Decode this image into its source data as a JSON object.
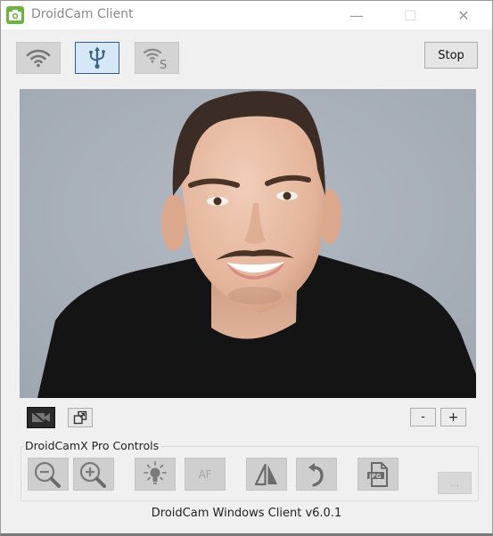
{
  "window": {
    "title": "DroidCam Client",
    "controls": {
      "minimize": "—",
      "maximize": "☐",
      "close": "✕"
    }
  },
  "connection": {
    "buttons": [
      {
        "id": "wifi",
        "icon": "wifi-icon",
        "active": false
      },
      {
        "id": "usb",
        "icon": "usb-icon",
        "active": true
      },
      {
        "id": "wifi-server",
        "icon": "wifi-s-icon",
        "label": "S",
        "active": false
      }
    ],
    "stop_label": "Stop"
  },
  "video": {
    "description": "Live camera preview: smiling man with short hair and mustache, black t-shirt, grey background",
    "background_color": "#a8b0ba"
  },
  "preview_controls": {
    "camera_toggle_icon": "camera-off-icon",
    "popout_icon": "popout-window-icon",
    "zoom_out_label": "-",
    "zoom_in_label": "+"
  },
  "pro_controls": {
    "group_label": "DroidCamX Pro Controls",
    "buttons": [
      {
        "id": "zoom-out",
        "icon": "zoom-out-icon"
      },
      {
        "id": "zoom-in",
        "icon": "zoom-in-icon"
      },
      {
        "id": "light",
        "icon": "lightbulb-icon"
      },
      {
        "id": "autofocus",
        "label": "AF"
      },
      {
        "id": "mirror",
        "icon": "mirror-flip-icon"
      },
      {
        "id": "rotate",
        "icon": "rotate-icon"
      },
      {
        "id": "save-jpg",
        "icon": "jpg-file-icon",
        "label": "JPG"
      }
    ],
    "more_label": "..."
  },
  "footer": {
    "version_text": "DroidCam Windows Client v6.0.1"
  }
}
